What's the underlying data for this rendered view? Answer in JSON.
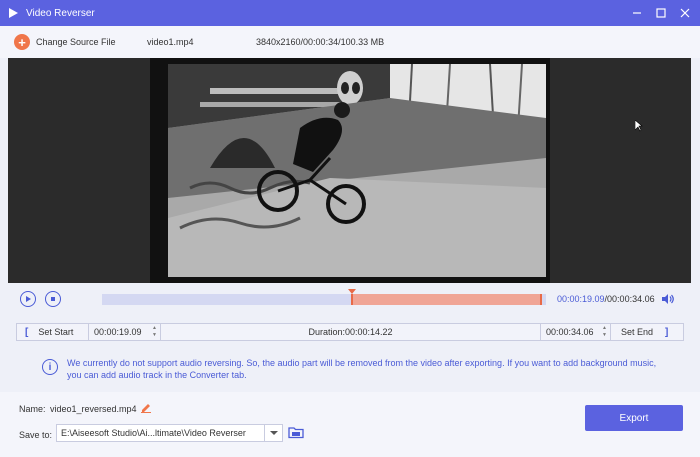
{
  "window": {
    "title": "Video Reverser",
    "accent": "#5b62e0"
  },
  "toolbar": {
    "change_source_label": "Change Source File",
    "file_name": "video1.mp4",
    "file_info": "3840x2160/00:00:34/100.33 MB"
  },
  "playback": {
    "current_time": "00:00:19.09",
    "total_time": "/00:00:34.06",
    "selection_start_fraction": 0.56,
    "selection_end_fraction": 1.0
  },
  "trim": {
    "set_start_label": "Set Start",
    "start_time": "00:00:19.09",
    "duration": "Duration:00:00:14.22",
    "end_time": "00:00:34.06",
    "set_end_label": "Set End"
  },
  "notice": {
    "text": "We currently do not support audio reversing. So, the audio part will be removed from the video after exporting. If you want to add background music, you can add audio track in the Converter tab."
  },
  "output": {
    "name_label": "Name:",
    "name_value": "video1_reversed.mp4",
    "save_label": "Save to:",
    "save_path": "E:\\Aiseesoft Studio\\Ai...ltimate\\Video Reverser",
    "export_label": "Export"
  }
}
